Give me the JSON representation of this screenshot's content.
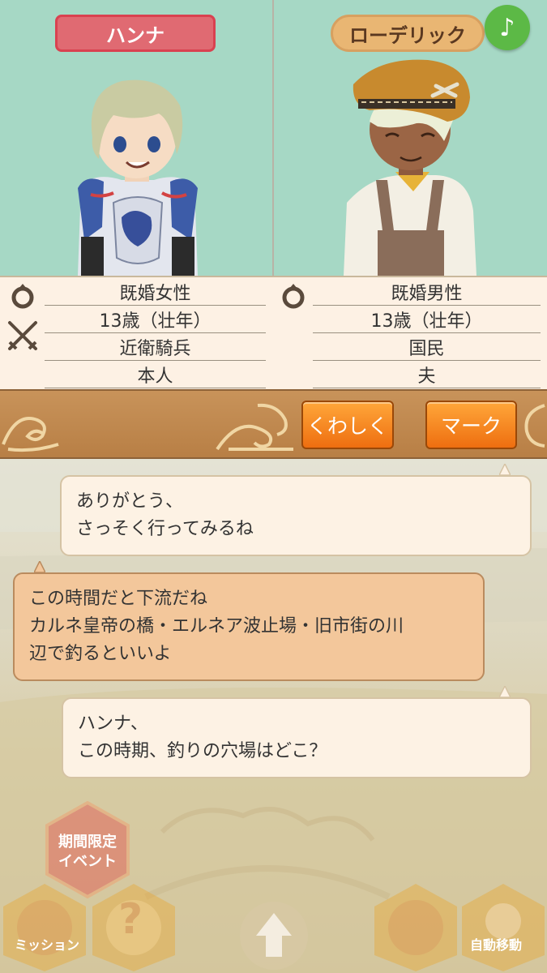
{
  "characters": {
    "left": {
      "name": "ハンナ",
      "marital_status": "既婚女性",
      "age": "13歳（壮年）",
      "occupation": "近衛騎兵",
      "relation": "本人"
    },
    "right": {
      "name": "ローデリック",
      "marital_status": "既婚男性",
      "age": "13歳（壮年）",
      "occupation": "国民",
      "relation": "夫"
    }
  },
  "icons": {
    "music": "♪",
    "ring": "ring-icon",
    "swords": "crossed-swords-icon"
  },
  "actions": {
    "details_label": "くわしく",
    "mark_label": "マーク"
  },
  "chat": [
    {
      "speaker": "right",
      "lines": [
        "ありがとう、",
        "さっそく行ってみるね"
      ]
    },
    {
      "speaker": "left",
      "lines": [
        "この時間だと下流だね",
        "カルネ皇帝の橋・エルネア波止場・旧市街の川",
        "辺で釣るといいよ"
      ]
    },
    {
      "speaker": "right",
      "lines": [
        "ハンナ、",
        "この時期、釣りの穴場はどこ？"
      ]
    }
  ],
  "bottom_menu": {
    "event_lines": [
      "期間限定",
      "イベント"
    ],
    "mission_label": "ミッション",
    "help_symbol": "?",
    "auto_move_label": "自動移動"
  },
  "colors": {
    "portrait_bg": "#a6d8c5",
    "left_name_tag": "#e06a72",
    "right_name_tag": "#e9b673",
    "action_button": "#f58a22",
    "music_button": "#5cb946",
    "left_bubble": "#f3c79b",
    "right_bubble": "#fdf2e4"
  }
}
